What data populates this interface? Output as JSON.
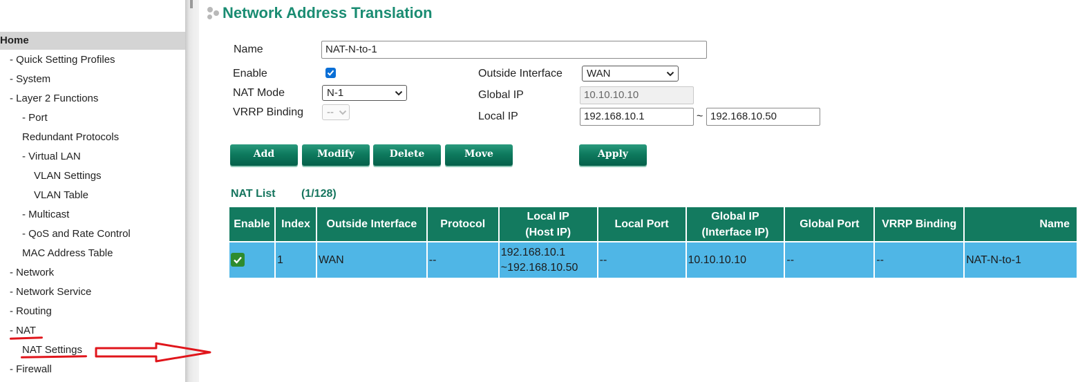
{
  "sidebar": {
    "home": "Home",
    "items": [
      {
        "label": "- Quick Setting Profiles"
      },
      {
        "label": "- System"
      },
      {
        "label": "- Layer 2 Functions"
      },
      {
        "label": "- Port"
      },
      {
        "label": "Redundant Protocols"
      },
      {
        "label": "- Virtual LAN"
      },
      {
        "label": "VLAN Settings"
      },
      {
        "label": "VLAN Table"
      },
      {
        "label": "- Multicast"
      },
      {
        "label": "- QoS and Rate Control"
      },
      {
        "label": "MAC Address Table"
      },
      {
        "label": "- Network"
      },
      {
        "label": "- Network Service"
      },
      {
        "label": "- Routing"
      },
      {
        "label": "- NAT"
      },
      {
        "label": "NAT Settings"
      },
      {
        "label": "- Firewall"
      }
    ]
  },
  "page": {
    "title": "Network Address Translation"
  },
  "form": {
    "name_label": "Name",
    "name_value": "NAT-N-to-1",
    "enable_label": "Enable",
    "enable_checked": true,
    "nat_mode_label": "NAT Mode",
    "nat_mode_value": "N-1",
    "vrrp_label": "VRRP Binding",
    "vrrp_value": "--",
    "outside_if_label": "Outside Interface",
    "outside_if_value": "WAN",
    "global_ip_label": "Global IP",
    "global_ip_value": "10.10.10.10",
    "local_ip_label": "Local IP",
    "local_ip_start": "192.168.10.1",
    "local_ip_sep": "~",
    "local_ip_end": "192.168.10.50"
  },
  "buttons": {
    "add": "Add",
    "modify": "Modify",
    "delete": "Delete",
    "move": "Move",
    "apply": "Apply"
  },
  "nat_list": {
    "title": "NAT List",
    "count": "(1/128)",
    "headers": {
      "enable": "Enable",
      "index": "Index",
      "outside_interface": "Outside Interface",
      "protocol": "Protocol",
      "local_ip_1": "Local IP",
      "local_ip_2": "(Host IP)",
      "local_port": "Local Port",
      "global_ip_1": "Global IP",
      "global_ip_2": "(Interface IP)",
      "global_port": "Global Port",
      "vrrp_binding": "VRRP Binding",
      "name": "Name"
    },
    "rows": [
      {
        "enabled": true,
        "index": "1",
        "outside_interface": "WAN",
        "protocol": "--",
        "local_ip_1": "192.168.10.1",
        "local_ip_2": "~192.168.10.50",
        "local_port": "--",
        "global_ip": "10.10.10.10",
        "global_port": "--",
        "vrrp_binding": "--",
        "name": "NAT-N-to-1"
      }
    ]
  },
  "colors": {
    "accent_green": "#137a5f",
    "title_green": "#1a8c72",
    "row_blue": "#4fb6e6",
    "annotation_red": "#e0151b"
  }
}
